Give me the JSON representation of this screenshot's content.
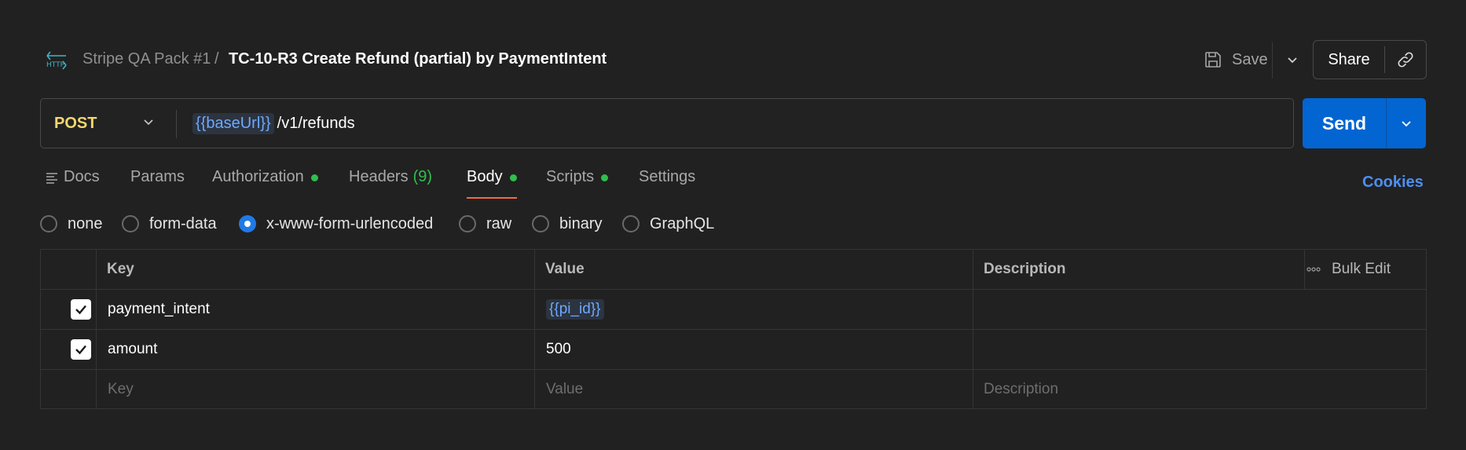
{
  "header": {
    "collection": "Stripe QA Pack #1",
    "separator": "/",
    "request_name": "TC-10-R3 Create Refund (partial) by PaymentIntent",
    "save_label": "Save",
    "share_label": "Share",
    "icon": "http-icon"
  },
  "request": {
    "method": "POST",
    "url_variable": "{{baseUrl}}",
    "url_path": "/v1/refunds",
    "send_label": "Send"
  },
  "tabs": [
    {
      "label": "Docs"
    },
    {
      "label": "Params"
    },
    {
      "label": "Authorization",
      "dot": true
    },
    {
      "label": "Headers",
      "count": "(9)"
    },
    {
      "label": "Body",
      "dot": true,
      "active": true
    },
    {
      "label": "Scripts",
      "dot": true
    },
    {
      "label": "Settings"
    }
  ],
  "cookies_label": "Cookies",
  "body_types": [
    {
      "label": "none"
    },
    {
      "label": "form-data"
    },
    {
      "label": "x-www-form-urlencoded",
      "selected": true
    },
    {
      "label": "raw"
    },
    {
      "label": "binary"
    },
    {
      "label": "GraphQL"
    }
  ],
  "table": {
    "headers": {
      "key": "Key",
      "value": "Value",
      "description": "Description",
      "bulk_edit": "Bulk Edit"
    },
    "rows": [
      {
        "checked": true,
        "key": "payment_intent",
        "value": "{{pi_id}}",
        "value_is_variable": true,
        "description": ""
      },
      {
        "checked": true,
        "key": "amount",
        "value": "500",
        "value_is_variable": false,
        "description": ""
      }
    ],
    "placeholder": {
      "key": "Key",
      "value": "Value",
      "description": "Description"
    }
  },
  "colors": {
    "background": "#212121",
    "method": "#f5d76e",
    "send": "#0265d2",
    "variable": "#6fa8ff",
    "status_dot": "#2fbf4d",
    "active_tab_underline": "#f26b3a",
    "cookies": "#4d8ff0"
  }
}
